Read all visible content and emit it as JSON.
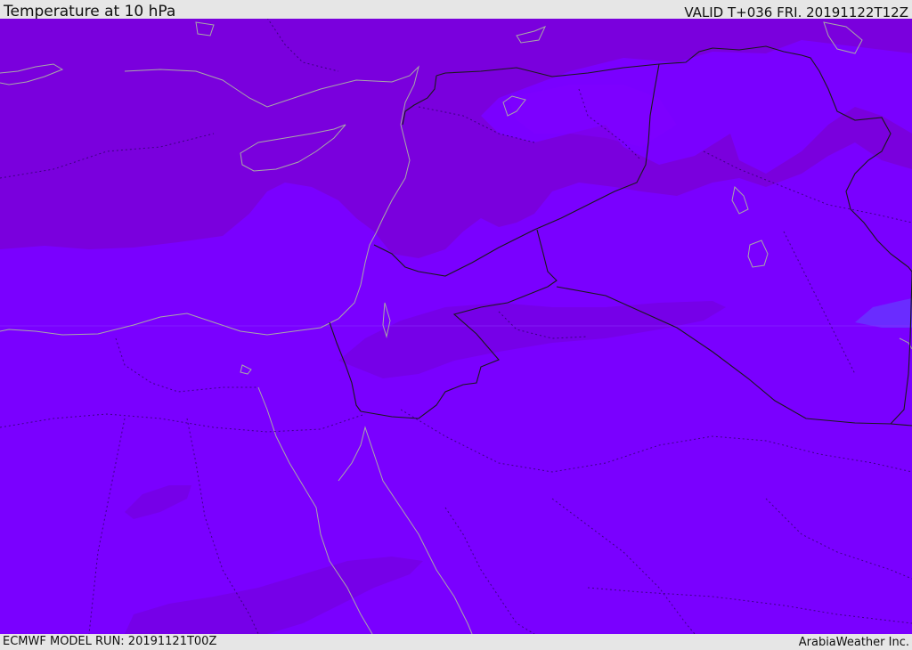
{
  "header": {
    "title": "Temperature at 10 hPa",
    "valid": "VALID T+036 FRI. 20191122T12Z"
  },
  "footer": {
    "model_run": "ECMWF MODEL RUN: 20191121T00Z",
    "credit": "ArabiaWeather Inc."
  },
  "map": {
    "field": "temperature",
    "level": "10 hPa",
    "colors": {
      "base": "#7a00ff",
      "warm_band": "#7a00dd",
      "cool_patch": "#8000ff",
      "coldest_patch": "#6a2cff",
      "coastline": "#a0a0a0",
      "border": "#202020"
    }
  }
}
